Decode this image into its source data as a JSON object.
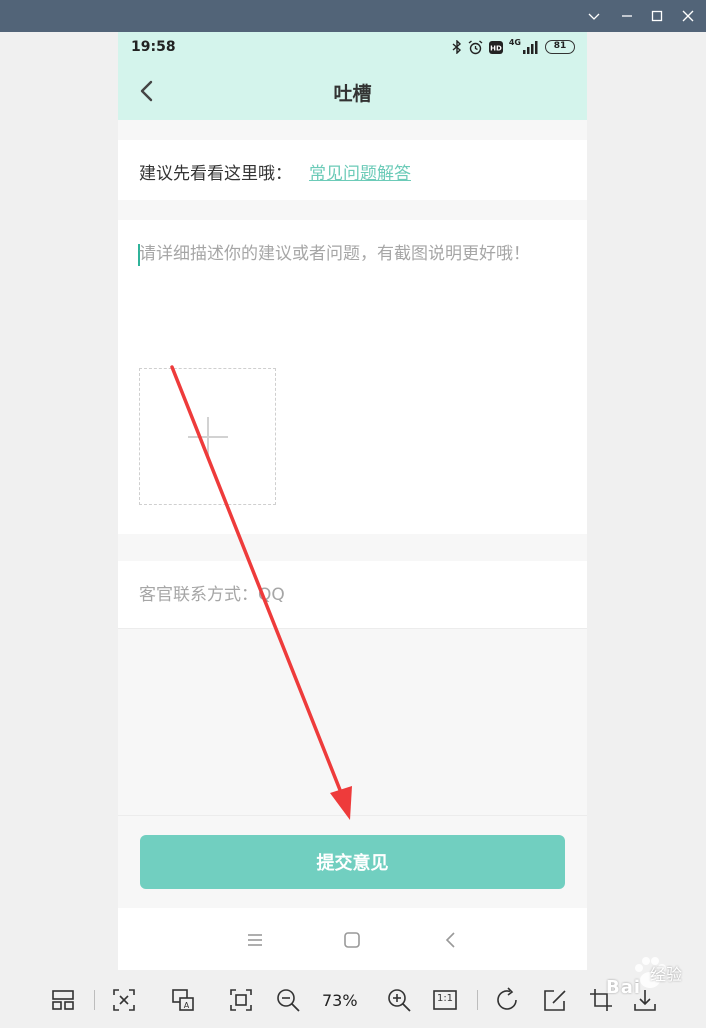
{
  "window": {
    "controls": [
      "chevron-down",
      "minimize",
      "restore",
      "close"
    ]
  },
  "status_bar": {
    "time": "19:58",
    "network": "4G",
    "battery": "81"
  },
  "nav": {
    "title": "吐槽"
  },
  "faq": {
    "prefix": "建议先看看这里哦：",
    "link": "常见问题解答"
  },
  "feedback": {
    "placeholder": "请详细描述你的建议或者问题，有截图说明更好哦！"
  },
  "contact": {
    "placeholder": "客官联系方式：QQ"
  },
  "submit": {
    "label": "提交意见"
  },
  "viewer": {
    "zoom": "73%",
    "actual_size": "1:1"
  },
  "watermark": {
    "brand": "Bai",
    "sub": "经验"
  },
  "colors": {
    "accent": "#71cfc0",
    "header_bg": "#d4f4ec",
    "link": "#6ccbb8",
    "titlebar": "#526478",
    "arrow": "#ee3b3b"
  }
}
